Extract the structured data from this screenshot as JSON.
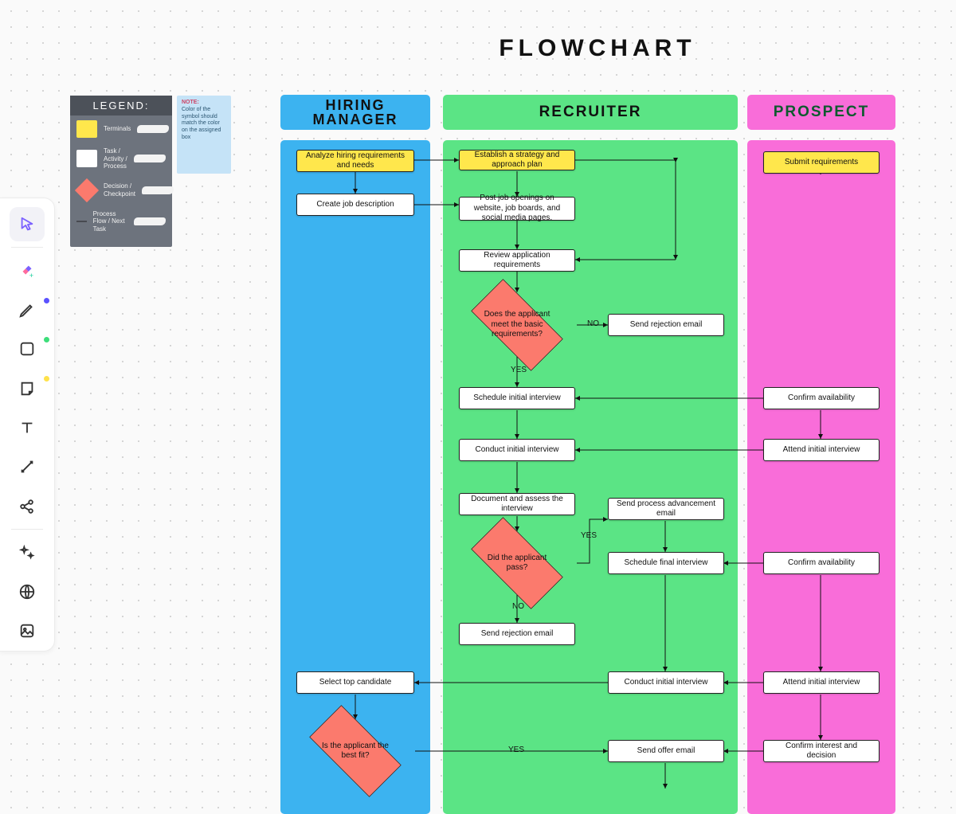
{
  "title": "FLOWCHART",
  "lanes": {
    "hiring_manager": "HIRING MANAGER",
    "recruiter": "RECRUITER",
    "prospect": "PROSPECT"
  },
  "legend": {
    "title": "LEGEND:",
    "terminals": "Terminals",
    "task": "Task / Activity / Process",
    "decision": "Decision / Checkpoint",
    "flow": "Process Flow / Next Task"
  },
  "note": {
    "label": "NOTE:",
    "body": "Color of the symbol should match the color on the assigned box"
  },
  "nodes": {
    "hm_analyze": "Analyze hiring requirements and needs",
    "hm_createjd": "Create job description",
    "hm_select": "Select top candidate",
    "hm_fit": "Is the applicant the best fit?",
    "r_strategy": "Establish a strategy and approach plan",
    "r_post": "Post job openings on website, job boards, and social media pages.",
    "r_reviewreq": "Review application requirements",
    "r_basicreq": "Does the applicant meet the basic requirements?",
    "r_rej1": "Send rejection email",
    "r_schedinit": "Schedule initial interview",
    "r_condinit": "Conduct initial interview",
    "r_docassess": "Document and assess the interview",
    "r_pass": "Did the applicant pass?",
    "r_rej2": "Send rejection email",
    "r_advance": "Send process advancement email",
    "r_schedfinal": "Schedule final interview",
    "r_condfinal": "Conduct initial interview",
    "r_offer": "Send offer email",
    "p_submit": "Submit requirements",
    "p_conf1": "Confirm availability",
    "p_attend1": "Attend initial interview",
    "p_conf2": "Confirm availability",
    "p_attend2": "Attend initial interview",
    "p_confirm_interest": "Confirm interest and decision"
  },
  "labels": {
    "yes": "YES",
    "no": "NO"
  }
}
